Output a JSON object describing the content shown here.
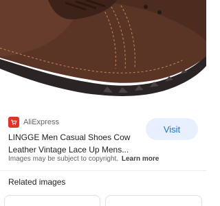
{
  "hero": {
    "image_description_icon": "brown-leather-lace-up-shoe"
  },
  "result": {
    "source": "AliExpress",
    "source_icon": "aliexpress-cart-icon",
    "title_line1": "LINGGE Men Casual Shoes Cow",
    "title_line2": "Leather Vintage Lace Up Mens...",
    "visit_label": "Visit",
    "copyright_text": "Images may be subject to copyright.",
    "learn_more_label": "Learn more"
  },
  "related": {
    "heading": "Related images"
  },
  "colors": {
    "accent": "#1a73e8",
    "visit_bg": "#e8f0fe",
    "brand_red": "#e43225",
    "shoe_brown": "#5a3526"
  }
}
